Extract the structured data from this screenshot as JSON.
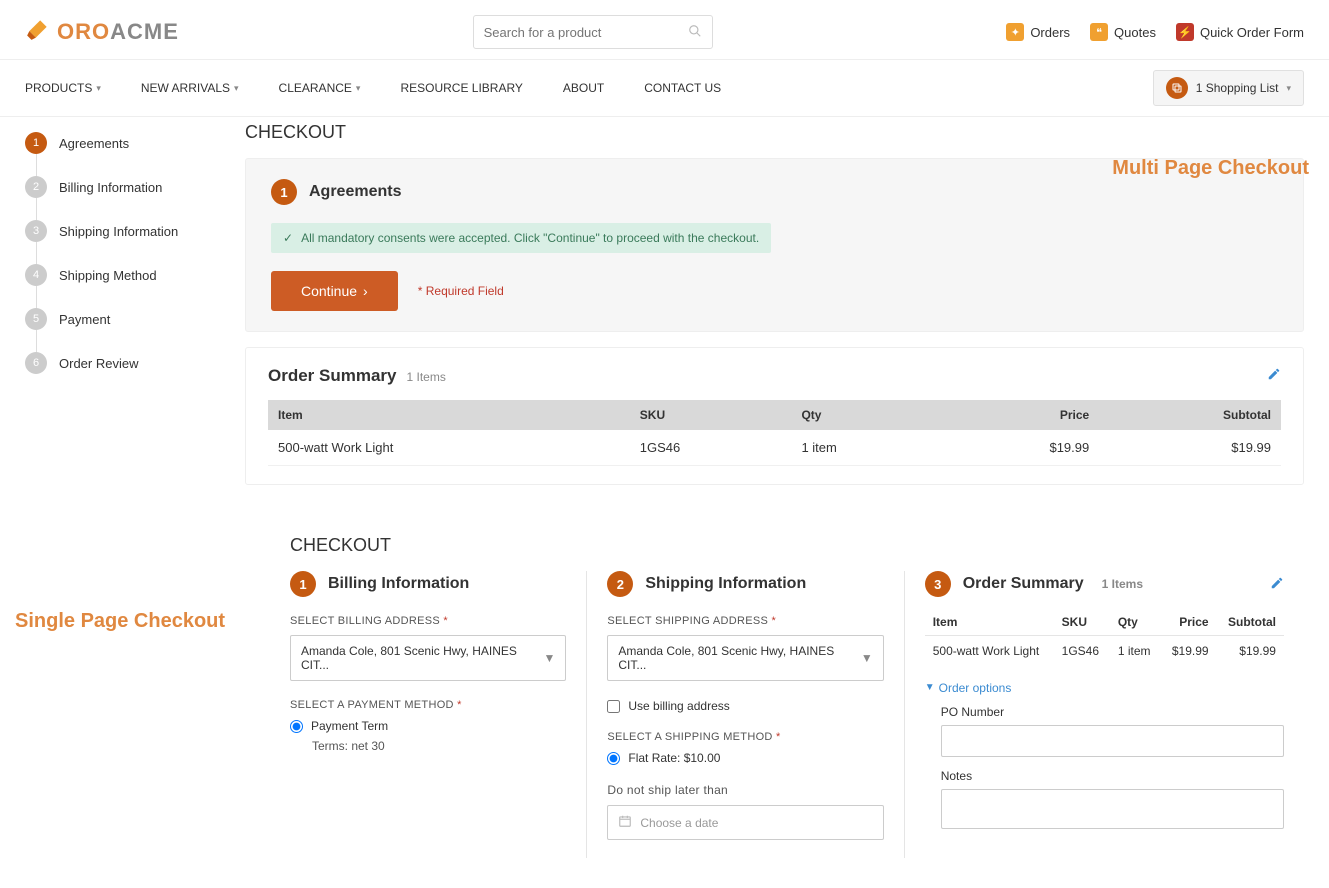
{
  "logo": {
    "part1": "ORO",
    "part2": "ACME"
  },
  "search": {
    "placeholder": "Search for a product"
  },
  "toplinks": {
    "orders": "Orders",
    "quotes": "Quotes",
    "quick": "Quick Order Form"
  },
  "nav": {
    "products": "PRODUCTS",
    "arrivals": "NEW ARRIVALS",
    "clearance": "CLEARANCE",
    "resource": "RESOURCE LIBRARY",
    "about": "ABOUT",
    "contact": "CONTACT US"
  },
  "cart": {
    "label": "1 Shopping List"
  },
  "annotations": {
    "multi": "Multi Page Checkout",
    "single": "Single Page Checkout"
  },
  "multi": {
    "steps": [
      {
        "n": "1",
        "label": "Agreements",
        "active": true
      },
      {
        "n": "2",
        "label": "Billing Information",
        "active": false
      },
      {
        "n": "3",
        "label": "Shipping Information",
        "active": false
      },
      {
        "n": "4",
        "label": "Shipping Method",
        "active": false
      },
      {
        "n": "5",
        "label": "Payment",
        "active": false
      },
      {
        "n": "6",
        "label": "Order Review",
        "active": false
      }
    ],
    "title": "CHECKOUT",
    "panel_title": "Agreements",
    "alert": "All mandatory consents were accepted. Click \"Continue\" to proceed with the checkout.",
    "continue": "Continue",
    "required": "* Required Field",
    "summary_title": "Order Summary",
    "summary_count": "1 Items",
    "cols": {
      "item": "Item",
      "sku": "SKU",
      "qty": "Qty",
      "price": "Price",
      "subtotal": "Subtotal"
    },
    "row": {
      "item": "500-watt Work Light",
      "sku": "1GS46",
      "qty": "1 item",
      "price": "$19.99",
      "subtotal": "$19.99"
    }
  },
  "single": {
    "title": "CHECKOUT",
    "billing": {
      "title": "Billing Information",
      "addr_label": "SELECT BILLING ADDRESS",
      "addr_value": "Amanda Cole, 801 Scenic Hwy, HAINES CIT...",
      "pay_label": "SELECT A PAYMENT METHOD",
      "pay_option": "Payment Term",
      "pay_terms": "Terms: net 30"
    },
    "shipping": {
      "title": "Shipping Information",
      "addr_label": "SELECT SHIPPING ADDRESS",
      "addr_value": "Amanda Cole, 801 Scenic Hwy, HAINES CIT...",
      "use_billing": "Use billing address",
      "method_label": "SELECT A SHIPPING METHOD",
      "method_option": "Flat Rate: $10.00",
      "date_label": "Do not ship later than",
      "date_placeholder": "Choose a date"
    },
    "summary": {
      "title": "Order Summary",
      "count": "1 Items",
      "cols": {
        "item": "Item",
        "sku": "SKU",
        "qty": "Qty",
        "price": "Price",
        "subtotal": "Subtotal"
      },
      "row": {
        "item": "500-watt Work Light",
        "sku": "1GS46",
        "qty": "1 item",
        "price": "$19.99",
        "subtotal": "$19.99"
      },
      "order_options": "Order options",
      "po_label": "PO Number",
      "notes_label": "Notes"
    }
  }
}
